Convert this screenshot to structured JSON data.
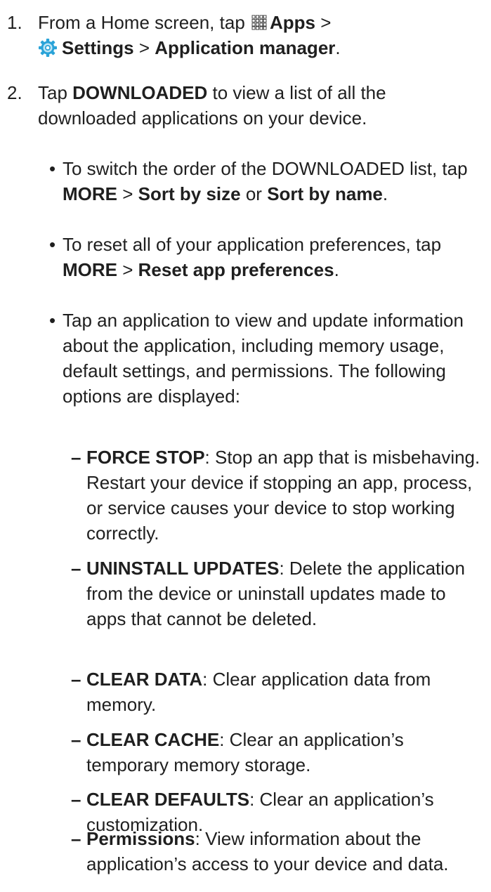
{
  "step1": {
    "number": "1.",
    "line1_pre": "From a Home screen, tap",
    "apps": "Apps",
    "sep1": ">",
    "settings": "Settings",
    "sep2": ">",
    "app_manager": "Application manager",
    "period": "."
  },
  "step2": {
    "number": "2.",
    "tap": "Tap",
    "downloaded": "DOWNLOADED",
    "rest": "to view a list of all the downloaded applications on your device."
  },
  "bullets": [
    {
      "pre": "To switch the order of the DOWNLOADED list, tap",
      "more": "MORE",
      "sep": ">",
      "opt1": "Sort by size",
      "or": "or",
      "opt2": "Sort by name",
      "period": "."
    },
    {
      "pre": "To reset all of your application preferences, tap",
      "more": "MORE",
      "sep": ">",
      "opt": "Reset app preferences",
      "period": "."
    },
    {
      "text": "Tap an application to view and update information about the application, including memory usage, default settings, and permissions. The following options are displayed:"
    }
  ],
  "options": [
    {
      "label": "FORCE STOP",
      "desc": ": Stop an app that is misbehaving. Restart your device if stopping an app, process, or service causes your device to stop working correctly."
    },
    {
      "label": "UNINSTALL UPDATES",
      "desc": ": Delete the application from the device or uninstall updates made to apps that cannot be deleted."
    },
    {
      "label": "CLEAR DATA",
      "desc": ": Clear application data from memory."
    },
    {
      "label": "CLEAR CACHE",
      "desc": ": Clear an application’s temporary memory storage."
    },
    {
      "label": "CLEAR DEFAULTS",
      "desc": ": Clear an application’s customization."
    },
    {
      "label": "Permissions",
      "desc": ": View information about the application’s access to your device and data."
    }
  ],
  "icons": {
    "apps": "apps-grid-icon",
    "settings": "settings-gear-icon",
    "accent": "#2aa3d8"
  }
}
